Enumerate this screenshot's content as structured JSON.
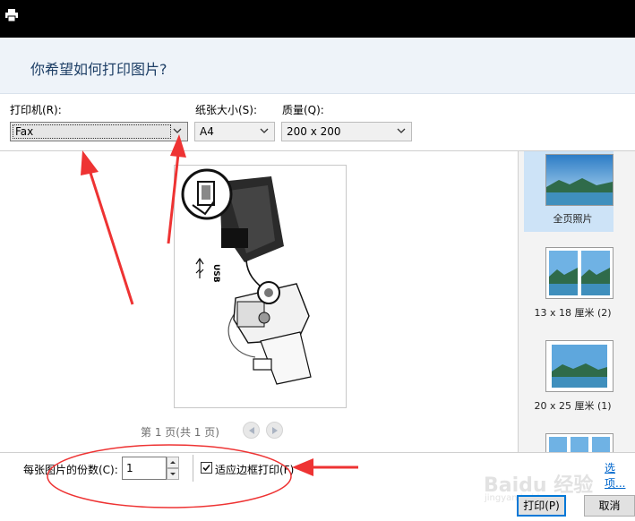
{
  "dialog": {
    "heading": "你希望如何打印图片?"
  },
  "controls": {
    "printer_label": "打印机(R):",
    "printer_value": "Fax",
    "paper_size_label": "纸张大小(S):",
    "paper_size_value": "A4",
    "quality_label": "质量(Q):",
    "quality_value": "200 x 200"
  },
  "preview": {
    "page_info": "第 1 页(共 1 页)",
    "usb_text": "USB"
  },
  "layouts": [
    {
      "label": "全页照片",
      "selected": true
    },
    {
      "label": "13 x 18 厘米 (2)",
      "selected": false
    },
    {
      "label": "20 x 25 厘米 (1)",
      "selected": false
    },
    {
      "label": "",
      "selected": false
    }
  ],
  "footer": {
    "copies_label": "每张图片的份数(C):",
    "copies_value": "1",
    "fit_label": "适应边框打印(F)",
    "fit_checked": true,
    "options_link": "选项...",
    "print_button": "打印(P)",
    "cancel_button": "取消"
  },
  "watermark": {
    "main": "Baidu 经验",
    "sub": "jingyan.baidu.com"
  },
  "colors": {
    "title_bar": "#000000",
    "header_bg": "#eef3f9",
    "heading_text": "#1e3f66",
    "selection": "#cde3f7",
    "annotation_red": "#ee3333",
    "link": "#0066cc"
  }
}
